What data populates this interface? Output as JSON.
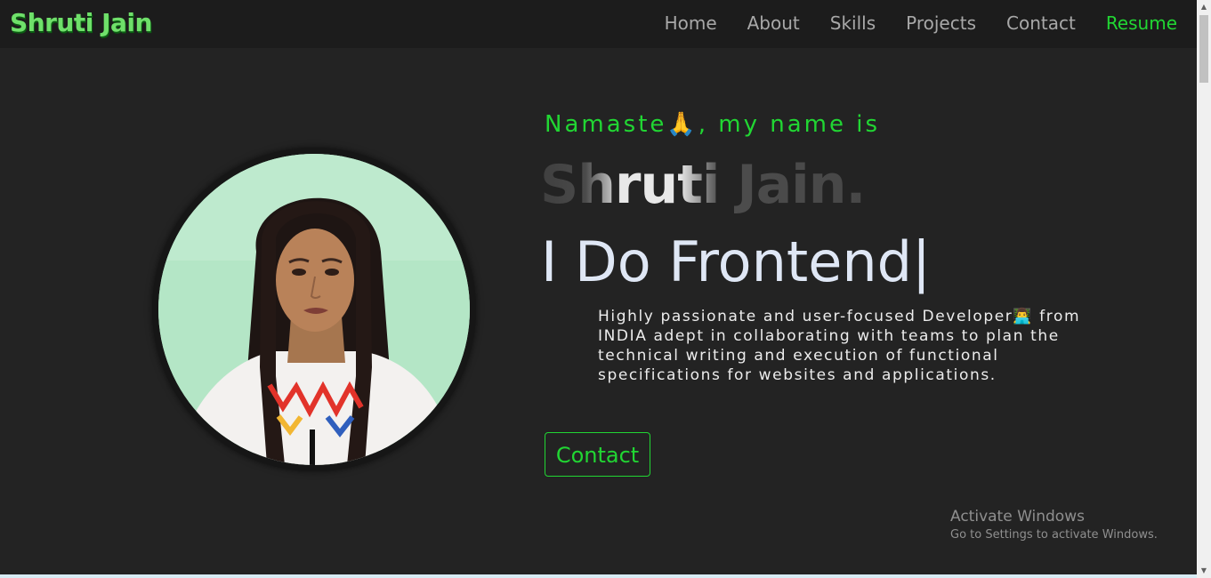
{
  "brand": {
    "name": "Shruti Jain"
  },
  "nav": {
    "items": [
      {
        "label": "Home"
      },
      {
        "label": "About"
      },
      {
        "label": "Skills"
      },
      {
        "label": "Projects"
      },
      {
        "label": "Contact"
      }
    ],
    "resume_label": "Resume"
  },
  "hero": {
    "greeting": "Namaste🙏, my name is",
    "name": "Shruti Jain.",
    "tagline": "I Do Frontend|",
    "description": "Highly passionate and user-focused Developer👨‍💻 from INDIA adept in collaborating with teams to plan the technical writing and execution of functional specifications for websites and applications.",
    "contact_label": "Contact",
    "avatar_icon": "profile-photo"
  },
  "watermark": {
    "title": "Activate Windows",
    "subtitle": "Go to Settings to activate Windows."
  },
  "colors": {
    "background": "#232323",
    "navbar": "#1c1c1c",
    "accent_green": "#21d633",
    "brand_green": "#6fe06a",
    "tagline": "#dfe7f5"
  }
}
